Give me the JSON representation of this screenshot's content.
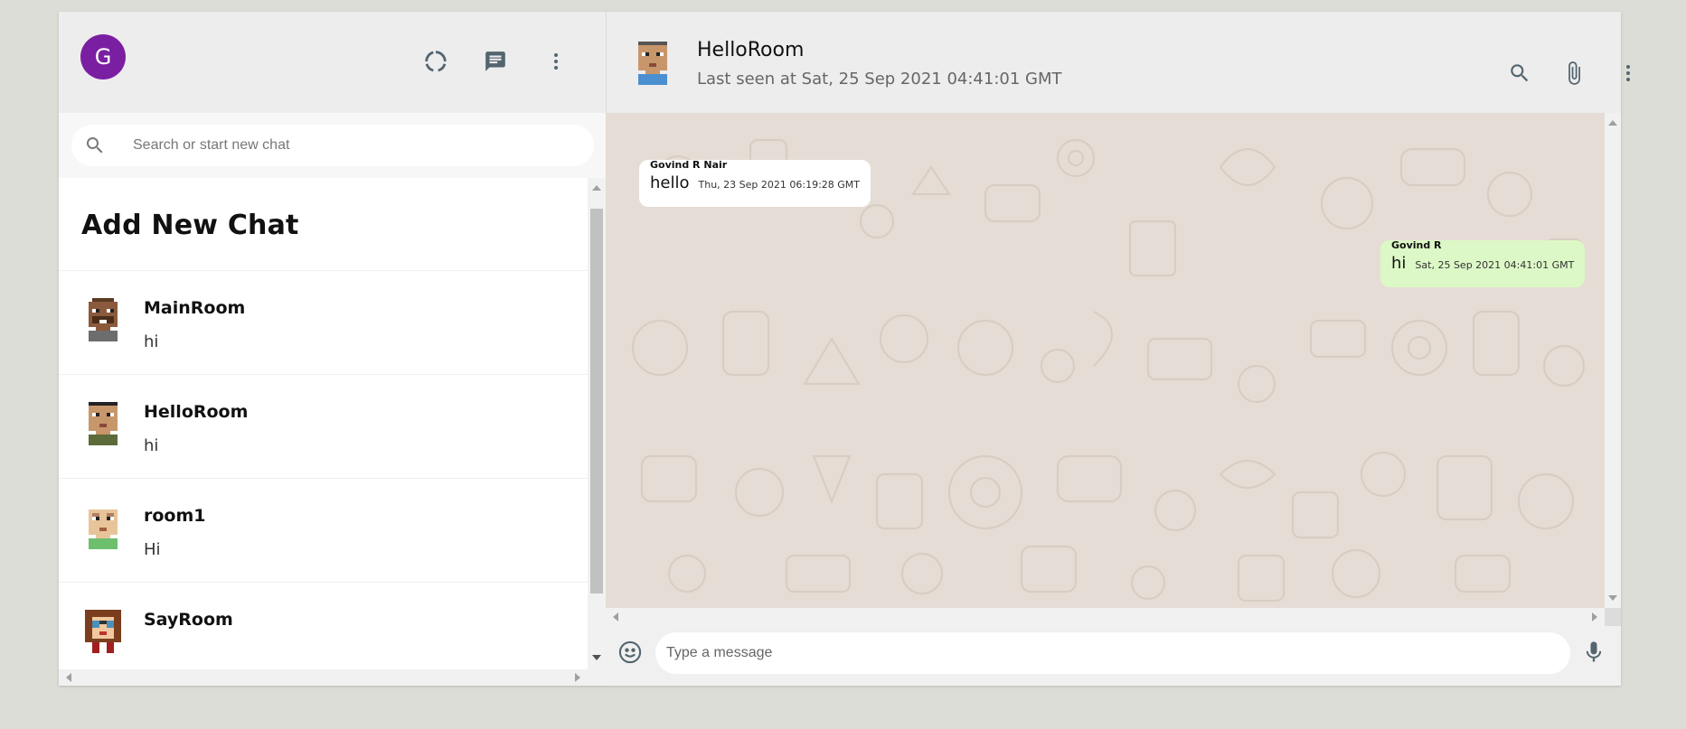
{
  "user": {
    "initial": "G",
    "avatar_color": "#7b1fa2"
  },
  "sidebar": {
    "header_icons": [
      "status-icon",
      "chat-icon",
      "more-vert-icon"
    ],
    "search_placeholder": "Search or start new chat",
    "add_new_chat": "Add New Chat",
    "chats": [
      {
        "name": "MainRoom",
        "last_message": "hi",
        "avatar": "avatar-mainroom"
      },
      {
        "name": "HelloRoom",
        "last_message": "hi",
        "avatar": "avatar-helloroom"
      },
      {
        "name": "room1",
        "last_message": "Hi",
        "avatar": "avatar-room1"
      },
      {
        "name": "SayRoom",
        "last_message": "",
        "avatar": "avatar-sayroom"
      }
    ]
  },
  "chat": {
    "room_name": "HelloRoom",
    "last_seen": "Last seen at Sat, 25 Sep 2021 04:41:01 GMT",
    "header_icons": [
      "search-icon",
      "attach-icon",
      "more-vert-icon"
    ],
    "messages": [
      {
        "sender": "Govind R Nair",
        "text": "hello",
        "time": "Thu, 23 Sep 2021 06:19:28 GMT",
        "direction": "received"
      },
      {
        "sender": "Govind R",
        "text": "hi",
        "time": "Sat, 25 Sep 2021 04:41:01 GMT",
        "direction": "sent"
      }
    ],
    "input_placeholder": "Type a message"
  },
  "colors": {
    "background": "#dcddd6",
    "header": "#ededed",
    "chat_bg": "#e5ddd5",
    "sent_bubble": "#dcf8c6",
    "received_bubble": "#ffffff"
  }
}
